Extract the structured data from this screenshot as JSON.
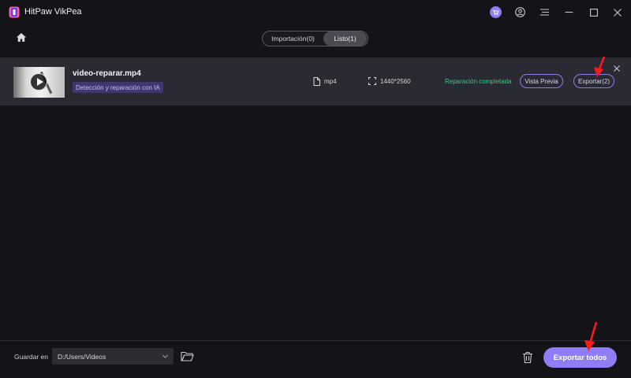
{
  "app": {
    "title": "HitPaw VikPea"
  },
  "titlebar_icons": [
    "cart-icon",
    "account-icon",
    "menu-icon",
    "minimize-icon",
    "maximize-icon",
    "close-icon"
  ],
  "tabs": [
    {
      "label": "Importación(0)",
      "active": false
    },
    {
      "label": "Listo(1)",
      "active": true
    }
  ],
  "file": {
    "name": "video-reparar.mp4",
    "badge": "Detección y reparación con IA",
    "format": "mp4",
    "resolution": "1440*2560",
    "status": "Reparación completada",
    "preview_label": "Vista Previa",
    "export_label": "Exportar(2)"
  },
  "footer": {
    "save_label": "Guardar en",
    "path": "D:/Users/Videos",
    "export_all_label": "Exportar todos"
  },
  "colors": {
    "background": "#141418",
    "row_bg": "#2a2a32",
    "accent": "#8f7df6",
    "status_green": "#37c98a",
    "badge_bg": "#3e3870",
    "annotation_red": "#ff1a1a"
  }
}
